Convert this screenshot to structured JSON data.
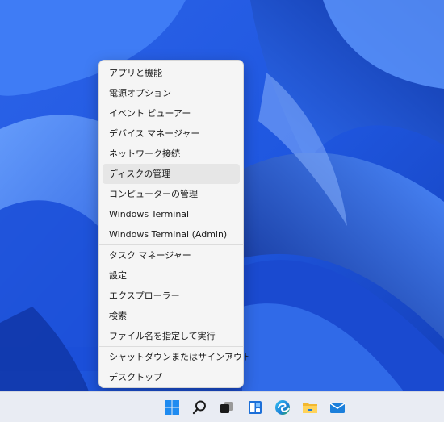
{
  "menu": {
    "group1": [
      {
        "label": "アプリと機能"
      },
      {
        "label": "電源オプション"
      },
      {
        "label": "イベント ビューアー"
      },
      {
        "label": "デバイス マネージャー"
      },
      {
        "label": "ネットワーク接続"
      },
      {
        "label": "ディスクの管理"
      },
      {
        "label": "コンピューターの管理"
      },
      {
        "label": "Windows Terminal"
      },
      {
        "label": "Windows Terminal (Admin)"
      }
    ],
    "group2": [
      {
        "label": "タスク マネージャー"
      },
      {
        "label": "設定"
      },
      {
        "label": "エクスプローラー"
      },
      {
        "label": "検索"
      },
      {
        "label": "ファイル名を指定して実行"
      }
    ],
    "group3": [
      {
        "label": "シャットダウンまたはサインアウト",
        "chevron": "›"
      },
      {
        "label": "デスクトップ"
      }
    ],
    "highlighted_item": "ディスクの管理"
  },
  "taskbar": {
    "icons": [
      "start-icon",
      "search-icon",
      "task-view-icon",
      "widgets-icon",
      "edge-icon",
      "file-explorer-icon",
      "mail-icon"
    ]
  },
  "colors": {
    "accent": "#0067c0",
    "wallpaper_blue": "#2f6df0",
    "menu_bg": "#f5f5f5",
    "taskbar_bg": "#e9ecf3"
  }
}
